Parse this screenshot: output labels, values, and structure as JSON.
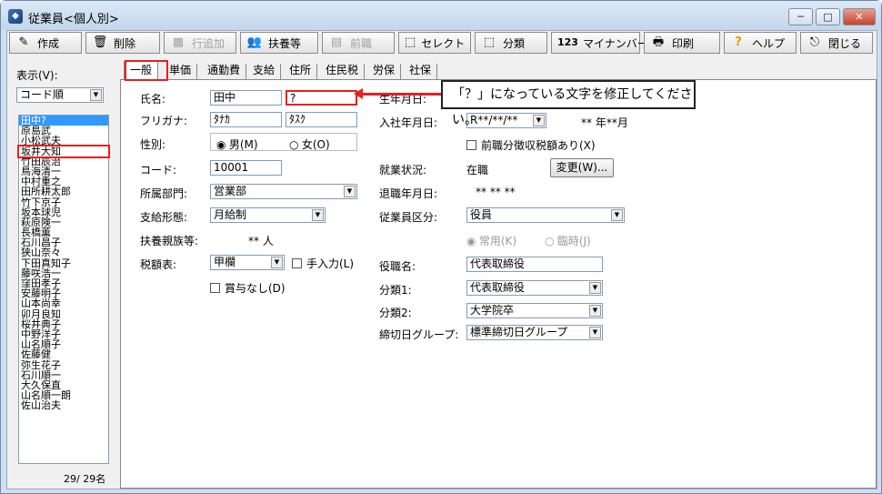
{
  "window": {
    "title": "従業員<個人別>"
  },
  "toolbar": {
    "create": "作成",
    "delete": "削除",
    "add_row": "行追加",
    "dependents": "扶養等",
    "prev_job": "前職",
    "select": "セレクト",
    "category": "分類",
    "mynumber": "マイナンバー",
    "print": "印刷",
    "help": "ヘルプ",
    "close": "閉じる"
  },
  "left": {
    "display_label": "表示(V):",
    "sort_value": "コード順",
    "employees": [
      "田中?",
      "原島武",
      "小松武夫",
      "坂井大知",
      "竹田辰治",
      "鳥海清一",
      "中村重之",
      "田所耕太郎",
      "竹下京子",
      "坂本球児",
      "萩原険一",
      "長橋薫",
      "石川昌子",
      "狭山奈々",
      "下田真知子",
      "藤咲浩一",
      "窪田孝子",
      "安藤明子",
      "山本尚幸",
      "卯月良知",
      "桜井典子",
      "中野洋子",
      "山名順子",
      "佐藤健",
      "弥生花子",
      "石川順一",
      "大久保直",
      "山名順一朗",
      "佐山治夫"
    ],
    "count": "29/ 29名"
  },
  "tabs": [
    "一般",
    "単価",
    "通勤費",
    "支給",
    "住所",
    "住民税",
    "労保",
    "社保"
  ],
  "form": {
    "name_label": "氏名:",
    "last_name": "田中",
    "first_name": "?",
    "kana_label": "フリガナ:",
    "last_kana": "ﾀﾅｶ",
    "first_kana": "ﾀｽｸ",
    "gender_label": "性別:",
    "male": "男(M)",
    "female": "女(O)",
    "code_label": "コード:",
    "code": "10001",
    "dept_label": "所属部門:",
    "dept": "営業部",
    "pay_label": "支給形態:",
    "pay": "月給制",
    "dependents_label": "扶養親族等:",
    "dependents_value": "** 人",
    "tax_label": "税額表:",
    "tax": "甲欄",
    "manual_input": "手入力(L)",
    "no_bonus": "賞与なし(D)",
    "birth_label": "生年月日:",
    "join_label": "入社年月日:",
    "join_date": "R**/**/**",
    "tenure": "** 年**月",
    "prev_tax": "前職分徴収税額あり(X)",
    "status_label": "就業状況:",
    "status": "在職",
    "change_button": "変更(W)...",
    "retire_label": "退職年月日:",
    "retire_value": "** ** **",
    "class_label": "従業員区分:",
    "class": "役員",
    "regular": "常用(K)",
    "temporary": "臨時(J)",
    "position_label": "役職名:",
    "position": "代表取締役",
    "cat1_label": "分類1:",
    "cat1": "代表取締役",
    "cat2_label": "分類2:",
    "cat2": "大学院卒",
    "closing_label": "締切日グループ:",
    "closing": "標準締切日グループ"
  },
  "callout": {
    "text": "「？」になっている文字を修正してください。"
  },
  "colors": {
    "highlight": "#e81f1f",
    "selection": "#3399ff"
  }
}
